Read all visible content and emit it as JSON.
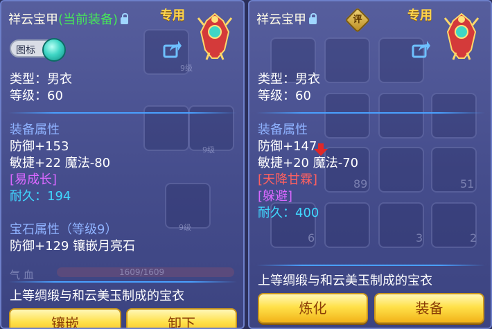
{
  "left": {
    "item_name": "祥云宝甲",
    "equipped_tag": "(当前装备)",
    "special_label": "专用",
    "toggle_label": "图标",
    "type_line": "类型：男衣",
    "level_line": "等级：60",
    "attributes_header": "装备属性",
    "attr_lines": [
      "防御+153",
      "敏捷+22 魔法-80"
    ],
    "special_effect": "[易成长]",
    "durability_label": "耐久：",
    "durability_value": "194",
    "gem_header": "宝石属性（等级9）",
    "gem_line": "防御+129 镶嵌月亮石",
    "description": "上等绸缎与和云美玉制成的宝衣",
    "buttons": [
      "镶嵌",
      "卸下"
    ],
    "background": {
      "grid_labels": [
        "9级",
        "9级",
        "9级"
      ],
      "hp_label": "气 血",
      "hp_value": "1609/1609"
    }
  },
  "right": {
    "item_name": "祥云宝甲",
    "rating_label": "评",
    "special_label": "专用",
    "type_line": "类型：男衣",
    "level_line": "等级：60",
    "attributes_header": "装备属性",
    "attr_line_1": "防御+147",
    "attr_line_2": "敏捷+20 魔法-70",
    "special_skill": "[天降甘霖]",
    "special_effect": "[躲避]",
    "durability_label": "耐久：",
    "durability_value": "400",
    "description": "上等绸缎与和云美玉制成的宝衣",
    "buttons": [
      "炼化",
      "装备"
    ],
    "background": {
      "grid_numbers": [
        "89",
        "51",
        "6",
        "3",
        "2"
      ]
    }
  },
  "colors": {
    "equipped": "#46e65a",
    "special": "#ffd34a",
    "header": "#8fb2ff",
    "effect_purple": "#d868ff",
    "effect_red": "#ff6060",
    "durability": "#40d8ff",
    "button": "#ffe14a"
  }
}
